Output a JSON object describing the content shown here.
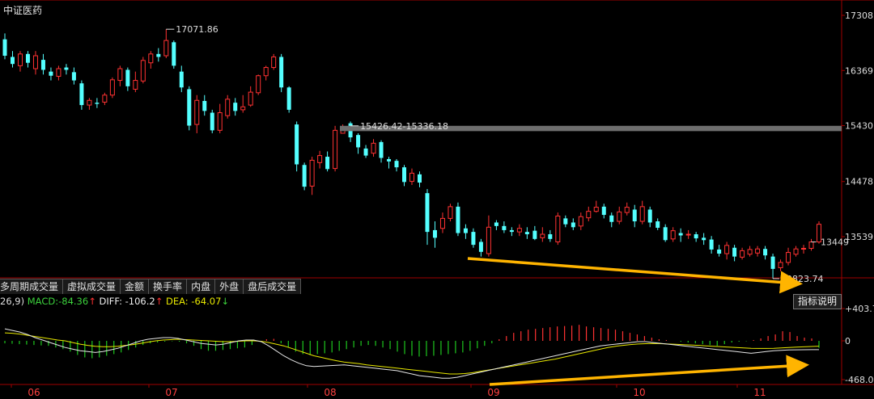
{
  "title": "中证医药",
  "tabs": [
    "多周期成交量",
    "虚拟成交量",
    "金额",
    "换手率",
    "内盘",
    "外盘",
    "盘后成交量"
  ],
  "macd_legend": {
    "prefix": "26,9)",
    "macd_label": "MACD:",
    "macd_value": "-84.36",
    "macd_arrow": "↑",
    "diff_label": "DIFF:",
    "diff_value": "-106.2",
    "diff_arrow": "↑",
    "dea_label": "DEA:",
    "dea_value": "-64.07",
    "dea_arrow": "↓"
  },
  "help_button": "指标说明",
  "annotations": {
    "high": "17071.86",
    "gap": "15426.42-15336.18",
    "low": "12823.74",
    "last": "13449"
  },
  "colors": {
    "up": "#ff3232",
    "down": "#54ffff",
    "diff": "#e6e6e6",
    "dea": "#e8e800",
    "arrow": "#ffb400",
    "gapband": "#6e6e6e"
  },
  "chart_data": [
    {
      "type": "candlestick",
      "price_axis_ticks": [
        "17308",
        "16369",
        "15430",
        "14478",
        "13539"
      ],
      "x_tick_labels": [
        "06",
        "07",
        "08",
        "09",
        "10",
        "11"
      ],
      "ylim": [
        12800,
        17400
      ],
      "candles": [
        [
          16900,
          16620,
          17000,
          16560
        ],
        [
          16600,
          16480,
          16700,
          16420
        ],
        [
          16450,
          16650,
          16700,
          16350
        ],
        [
          16650,
          16500,
          16700,
          16420
        ],
        [
          16400,
          16620,
          16700,
          16300
        ],
        [
          16550,
          16380,
          16650,
          16300
        ],
        [
          16350,
          16280,
          16420,
          16200
        ],
        [
          16270,
          16400,
          16450,
          16200
        ],
        [
          16420,
          16380,
          16480,
          16300
        ],
        [
          16340,
          16200,
          16420,
          16130
        ],
        [
          16150,
          15780,
          16200,
          15700
        ],
        [
          15780,
          15860,
          15900,
          15700
        ],
        [
          15820,
          15800,
          15900,
          15730
        ],
        [
          15830,
          15950,
          15990,
          15780
        ],
        [
          15950,
          16210,
          16250,
          15900
        ],
        [
          16200,
          16400,
          16450,
          16100
        ],
        [
          16380,
          16100,
          16420,
          16020
        ],
        [
          16050,
          16200,
          16350,
          16000
        ],
        [
          16190,
          16540,
          16600,
          16150
        ],
        [
          16500,
          16650,
          16700,
          16400
        ],
        [
          16650,
          16600,
          16750,
          16520
        ],
        [
          16620,
          16880,
          17071.86,
          16580
        ],
        [
          16850,
          16450,
          16880,
          16400
        ],
        [
          16350,
          16080,
          16450,
          16000
        ],
        [
          16050,
          15430,
          16100,
          15350
        ],
        [
          15450,
          15860,
          15950,
          15300
        ],
        [
          15850,
          15680,
          15950,
          15600
        ],
        [
          15650,
          15350,
          15700,
          15300
        ],
        [
          15350,
          15650,
          15800,
          15300
        ],
        [
          15600,
          15880,
          15950,
          15550
        ],
        [
          15820,
          15680,
          15900,
          15600
        ],
        [
          15700,
          15750,
          15950,
          15650
        ],
        [
          15780,
          16000,
          16100,
          15750
        ],
        [
          15990,
          16280,
          16300,
          15950
        ],
        [
          16280,
          16420,
          16450,
          16200
        ],
        [
          16420,
          16600,
          16650,
          16380
        ],
        [
          16600,
          16080,
          16650,
          16000
        ],
        [
          16080,
          15700,
          16100,
          15650
        ],
        [
          15450,
          14770,
          15500,
          14650
        ],
        [
          14760,
          14390,
          14800,
          14330
        ],
        [
          14400,
          14840,
          14900,
          14250
        ],
        [
          14800,
          14920,
          15000,
          14700
        ],
        [
          14900,
          14690,
          14990,
          14650
        ],
        [
          14700,
          15350,
          15426,
          14650
        ],
        [
          15300,
          15380,
          15450,
          15300
        ],
        [
          15470,
          15230,
          15500,
          15150
        ],
        [
          15270,
          15060,
          15300,
          14950
        ],
        [
          15040,
          14920,
          15100,
          14880
        ],
        [
          14960,
          15130,
          15200,
          14900
        ],
        [
          15150,
          14880,
          15180,
          14800
        ],
        [
          14860,
          14820,
          14900,
          14700
        ],
        [
          14830,
          14720,
          14860,
          14650
        ],
        [
          14720,
          14470,
          14760,
          14400
        ],
        [
          14480,
          14620,
          14700,
          14420
        ],
        [
          14600,
          14460,
          14650,
          14380
        ],
        [
          14280,
          13620,
          14350,
          13400
        ],
        [
          13650,
          13520,
          13800,
          13350
        ],
        [
          13680,
          13850,
          13950,
          13600
        ],
        [
          13850,
          14050,
          14100,
          13800
        ],
        [
          14050,
          13600,
          14120,
          13550
        ],
        [
          13680,
          13600,
          13750,
          13500
        ],
        [
          13620,
          13400,
          13680,
          13350
        ],
        [
          13450,
          13280,
          13500,
          13200
        ],
        [
          13250,
          13700,
          13900,
          13200
        ],
        [
          13780,
          13720,
          13820,
          13650
        ],
        [
          13720,
          13650,
          13800,
          13600
        ],
        [
          13650,
          13620,
          13700,
          13550
        ],
        [
          13620,
          13680,
          13750,
          13550
        ],
        [
          13620,
          13580,
          13700,
          13500
        ],
        [
          13640,
          13500,
          13720,
          13480
        ],
        [
          13520,
          13580,
          13700,
          13450
        ],
        [
          13580,
          13500,
          13650,
          13450
        ],
        [
          13450,
          13890,
          13950,
          13400
        ],
        [
          13850,
          13750,
          13900,
          13700
        ],
        [
          13780,
          13700,
          13850,
          13650
        ],
        [
          13720,
          13880,
          13950,
          13650
        ],
        [
          13860,
          13970,
          14050,
          13800
        ],
        [
          13970,
          14040,
          14150,
          13950
        ],
        [
          14050,
          13910,
          14100,
          13850
        ],
        [
          13900,
          13790,
          13950,
          13700
        ],
        [
          13800,
          13960,
          14050,
          13750
        ],
        [
          13950,
          14040,
          14120,
          13900
        ],
        [
          14000,
          13800,
          14080,
          13700
        ],
        [
          13800,
          14050,
          14150,
          13750
        ],
        [
          14000,
          13780,
          14050,
          13700
        ],
        [
          13800,
          13690,
          13850,
          13650
        ],
        [
          13700,
          13480,
          13750,
          13450
        ],
        [
          13500,
          13640,
          13700,
          13450
        ],
        [
          13600,
          13560,
          13680,
          13450
        ],
        [
          13580,
          13580,
          13650,
          13500
        ],
        [
          13580,
          13510,
          13620,
          13450
        ],
        [
          13520,
          13480,
          13600,
          13400
        ],
        [
          13490,
          13320,
          13550,
          13250
        ],
        [
          13320,
          13250,
          13400,
          13200
        ],
        [
          13250,
          13390,
          13450,
          13150
        ],
        [
          13350,
          13200,
          13400,
          13120
        ],
        [
          13190,
          13300,
          13350,
          13150
        ],
        [
          13240,
          13320,
          13380,
          13200
        ],
        [
          13260,
          13330,
          13380,
          13200
        ],
        [
          13330,
          13220,
          13380,
          13150
        ],
        [
          13200,
          12990,
          13250,
          12823.74
        ],
        [
          13010,
          13100,
          13150,
          12950
        ],
        [
          13100,
          13270,
          13350,
          13050
        ],
        [
          13240,
          13330,
          13380,
          13200
        ],
        [
          13330,
          13340,
          13400,
          13250
        ],
        [
          13340,
          13449,
          13500,
          13300
        ],
        [
          13449,
          13750,
          13800,
          13420
        ]
      ]
    },
    {
      "type": "macd",
      "ytick_labels": [
        "+403.7",
        "0",
        "-468.0"
      ],
      "ylim": [
        -468,
        403.7
      ],
      "macd": [
        -30,
        -35,
        -40,
        -45,
        -50,
        -55,
        -60,
        -80,
        -100,
        -130,
        -170,
        -200,
        -210,
        -200,
        -180,
        -160,
        -140,
        -110,
        -80,
        -50,
        -30,
        -20,
        -10,
        -5,
        -10,
        -30,
        -60,
        -100,
        -120,
        -120,
        -110,
        -100,
        -90,
        -80,
        -50,
        -10,
        20,
        25,
        -30,
        -80,
        -130,
        -160,
        -170,
        -160,
        -150,
        -140,
        -120,
        -100,
        -80,
        -60,
        -50,
        -60,
        -80,
        -100,
        -130,
        -160,
        -180,
        -190,
        -185,
        -180,
        -170,
        -160,
        -150,
        -140,
        -120,
        -90,
        -60,
        -30,
        20,
        60,
        100,
        120,
        140,
        150,
        160,
        170,
        180,
        185,
        190,
        200,
        180,
        170,
        160,
        150,
        140,
        120,
        100,
        80,
        60,
        40,
        20,
        10,
        0,
        -10,
        -20,
        -30,
        -40,
        -50,
        -60,
        -40,
        -20,
        -10,
        -5,
        10,
        30,
        60,
        80,
        120,
        110,
        60,
        40,
        30,
        -84.36
      ],
      "diff": [
        150,
        130,
        110,
        80,
        40,
        10,
        -20,
        -50,
        -80,
        -100,
        -120,
        -130,
        -140,
        -130,
        -110,
        -90,
        -60,
        -30,
        0,
        20,
        30,
        40,
        40,
        30,
        10,
        -10,
        -30,
        -40,
        -50,
        -40,
        -20,
        0,
        10,
        10,
        -10,
        -60,
        -120,
        -180,
        -230,
        -270,
        -300,
        -310,
        -305,
        -300,
        -295,
        -290,
        -300,
        -310,
        -320,
        -330,
        -340,
        -350,
        -360,
        -380,
        -400,
        -420,
        -430,
        -440,
        -450,
        -450,
        -440,
        -420,
        -400,
        -380,
        -360,
        -340,
        -320,
        -300,
        -280,
        -260,
        -240,
        -220,
        -200,
        -180,
        -160,
        -140,
        -120,
        -100,
        -80,
        -60,
        -50,
        -40,
        -30,
        -20,
        -10,
        -10,
        -20,
        -30,
        -40,
        -50,
        -60,
        -70,
        -80,
        -90,
        -100,
        -110,
        -120,
        -130,
        -140,
        -150,
        -140,
        -130,
        -120,
        -115,
        -110,
        -108,
        -107,
        -106.5,
        -106.2
      ],
      "dea": [
        100,
        95,
        85,
        70,
        55,
        40,
        25,
        10,
        0,
        -20,
        -40,
        -55,
        -65,
        -70,
        -70,
        -65,
        -55,
        -45,
        -30,
        -15,
        0,
        10,
        15,
        20,
        15,
        10,
        5,
        0,
        -5,
        -10,
        -10,
        -5,
        0,
        0,
        -5,
        -20,
        -40,
        -60,
        -90,
        -120,
        -150,
        -180,
        -200,
        -220,
        -240,
        -255,
        -265,
        -275,
        -290,
        -300,
        -310,
        -320,
        -330,
        -340,
        -350,
        -360,
        -370,
        -380,
        -390,
        -400,
        -400,
        -395,
        -385,
        -370,
        -355,
        -340,
        -325,
        -310,
        -295,
        -280,
        -265,
        -250,
        -235,
        -220,
        -200,
        -180,
        -160,
        -140,
        -120,
        -100,
        -80,
        -65,
        -55,
        -45,
        -38,
        -34,
        -32,
        -34,
        -38,
        -42,
        -46,
        -50,
        -55,
        -60,
        -65,
        -70,
        -75,
        -80,
        -85,
        -90,
        -92,
        -92,
        -90,
        -85,
        -80,
        -76,
        -72,
        -68,
        -64.07
      ]
    }
  ]
}
